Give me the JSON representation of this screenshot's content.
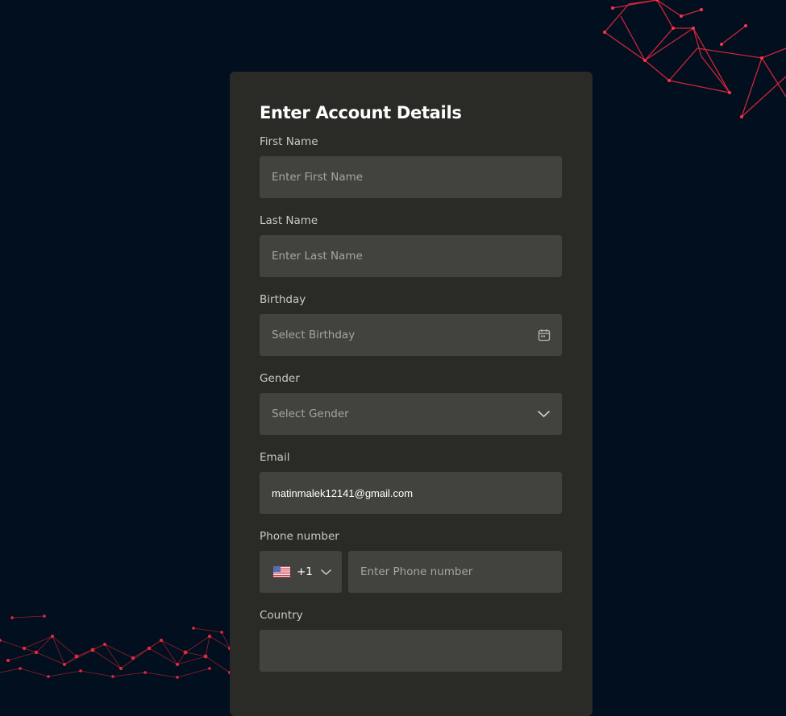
{
  "form": {
    "title": "Enter Account Details",
    "first_name": {
      "label": "First Name",
      "placeholder": "Enter First Name"
    },
    "last_name": {
      "label": "Last Name",
      "placeholder": "Enter Last Name"
    },
    "birthday": {
      "label": "Birthday",
      "placeholder": "Select Birthday",
      "icon": "calendar-icon"
    },
    "gender": {
      "label": "Gender",
      "placeholder": "Select Gender",
      "icon": "chevron-down-icon"
    },
    "email": {
      "label": "Email",
      "value": "matinmalek12141@gmail.com"
    },
    "phone": {
      "label": "Phone number",
      "country_code": "+1",
      "flag": "us-flag-icon",
      "placeholder": "Enter Phone number"
    },
    "country": {
      "label": "Country"
    }
  },
  "colors": {
    "page_background": "#020f1f",
    "card_background": "#2a2a27",
    "input_background": "#42423e",
    "accent_network": "#e8283c"
  }
}
